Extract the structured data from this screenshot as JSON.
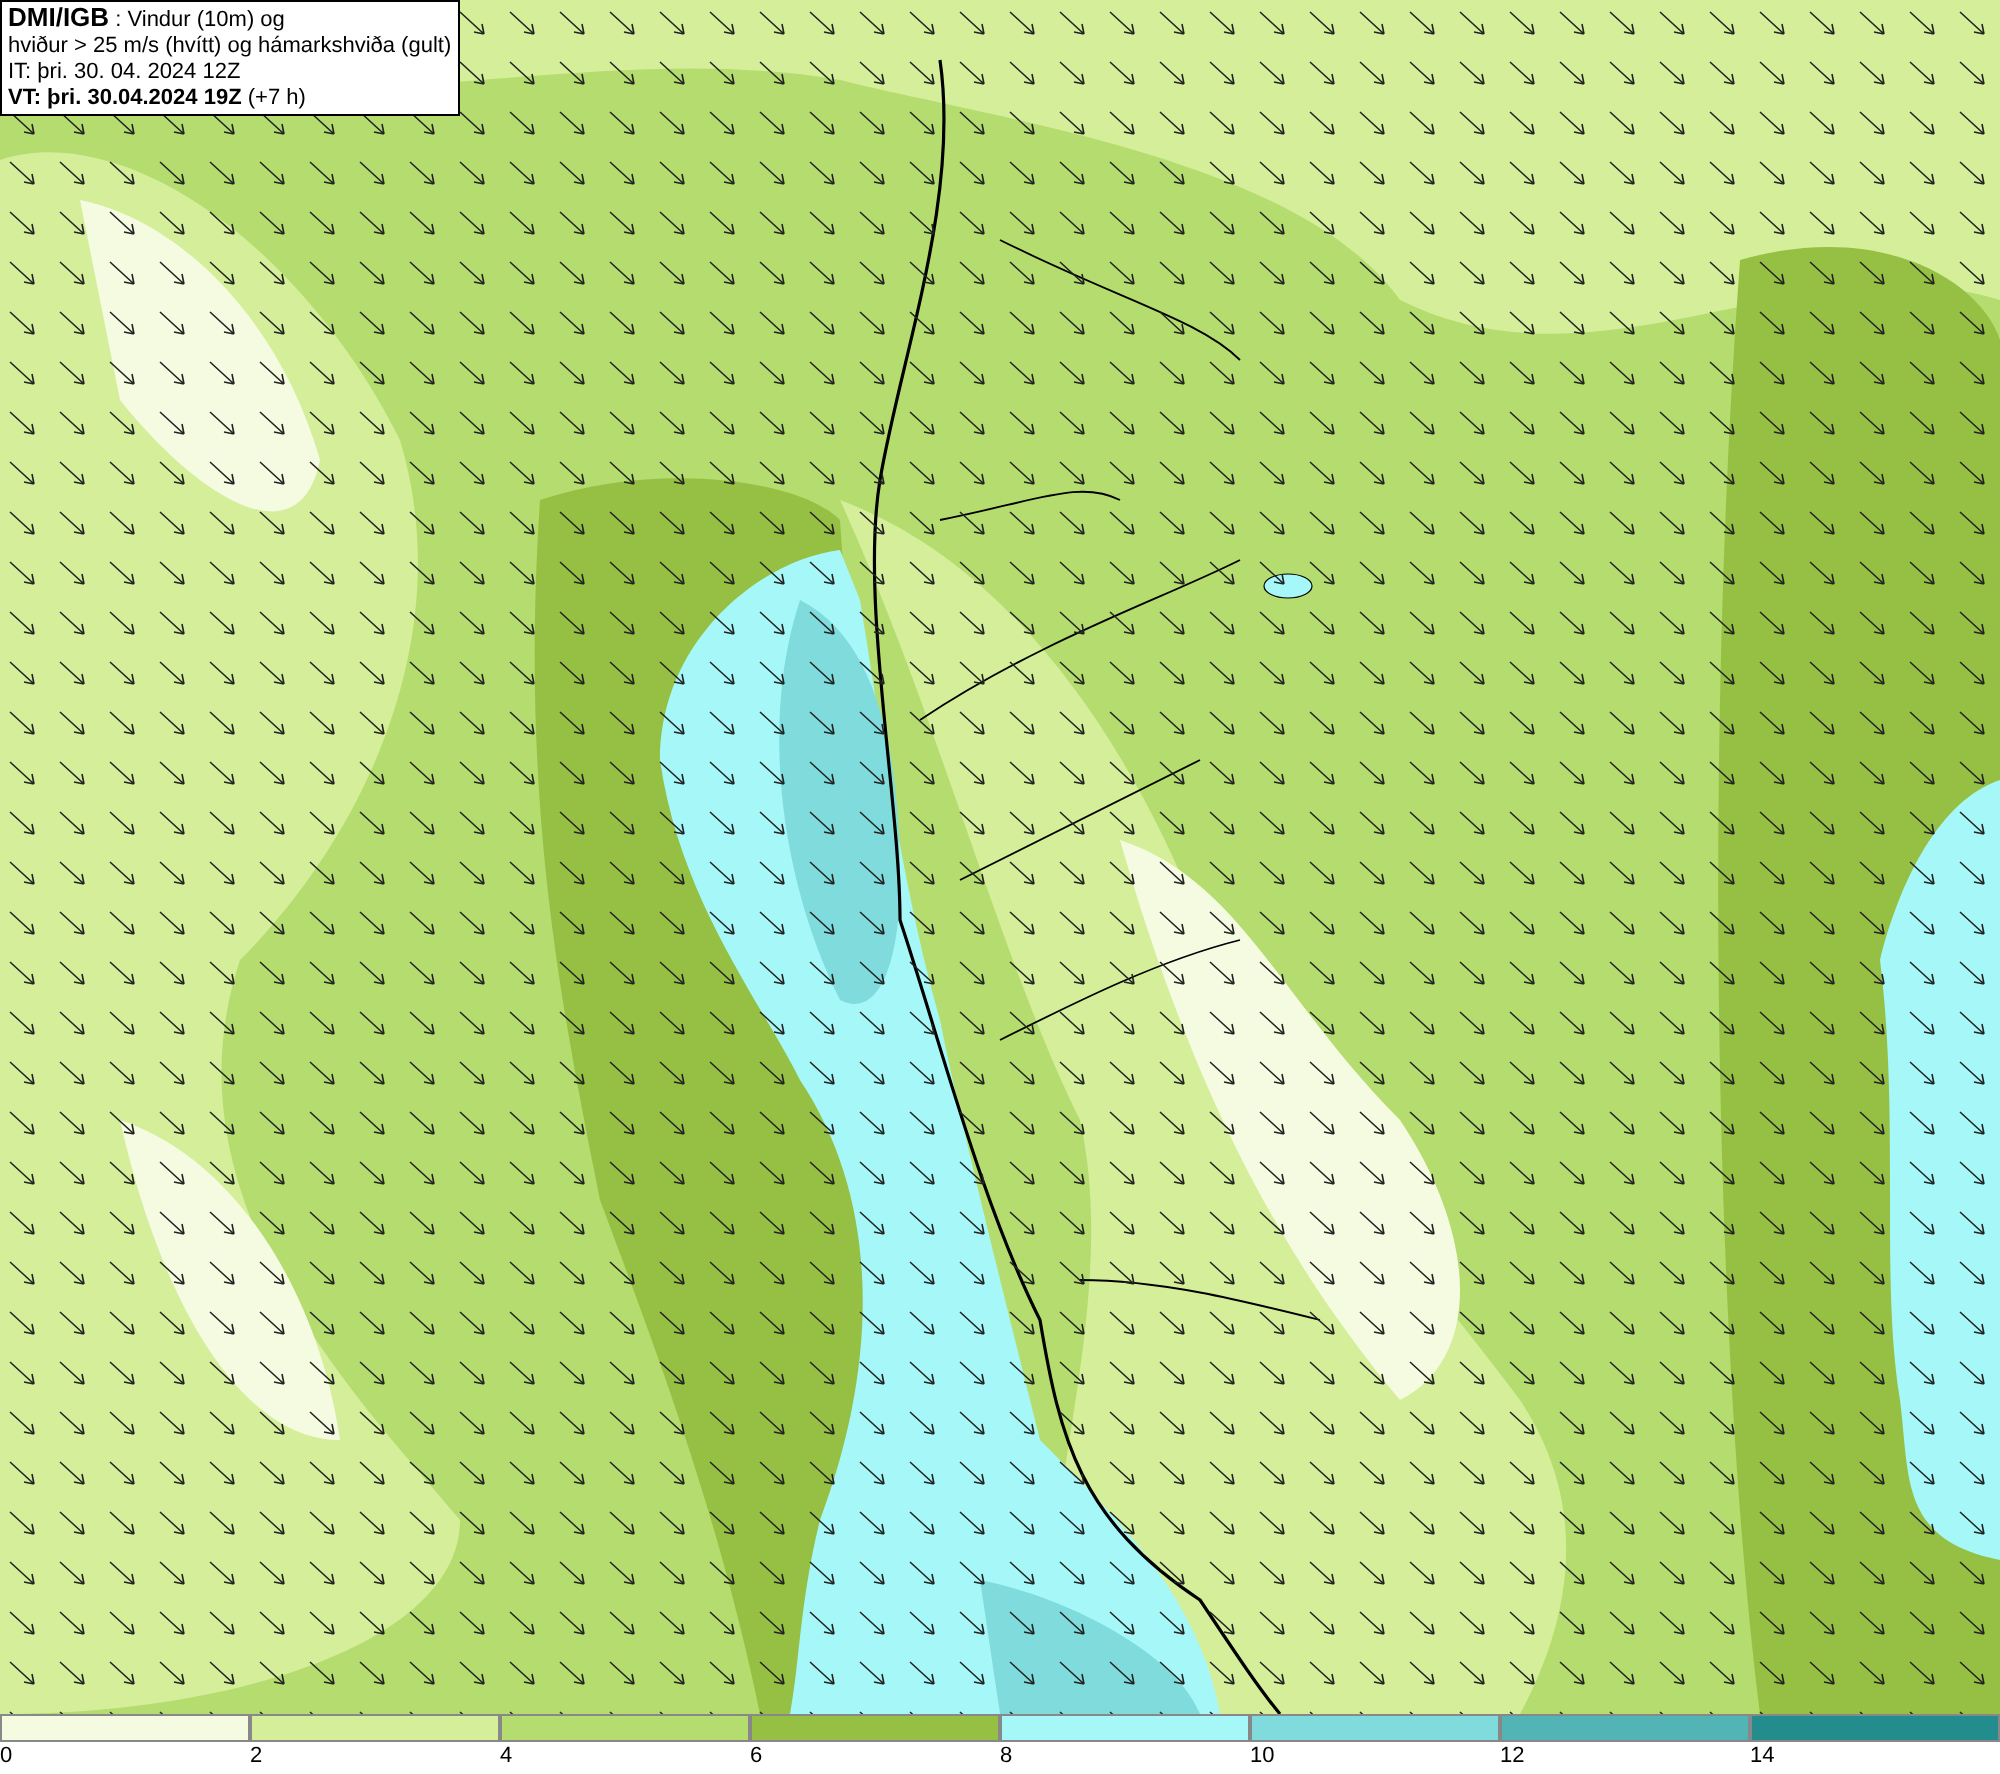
{
  "info_box": {
    "line_1": "**DMI/IGB** : Vindur (10m) og",
    "line_2": "hviður > 25 m/s (hvítt) og hámarkshviða (gult)",
    "line_3": "IT: þri. 30. 04. 2024 12Z",
    "line_4": "**VT: þri. 30.04.2024 19Z** (+7 h)"
  },
  "colorbar": {
    "bins": [
      {
        "color": "#f5fbe0",
        "tick": "0"
      },
      {
        "color": "#d4ee9a",
        "tick": "2"
      },
      {
        "color": "#b4dc6e",
        "tick": "4"
      },
      {
        "color": "#96c043",
        "tick": "6"
      },
      {
        "color": "#a6f8f8",
        "tick": "8"
      },
      {
        "color": "#80dcdc",
        "tick": "10"
      },
      {
        "color": "#52b4b4",
        "tick": "12"
      },
      {
        "color": "#238c8c",
        "tick": "14"
      }
    ]
  }
}
